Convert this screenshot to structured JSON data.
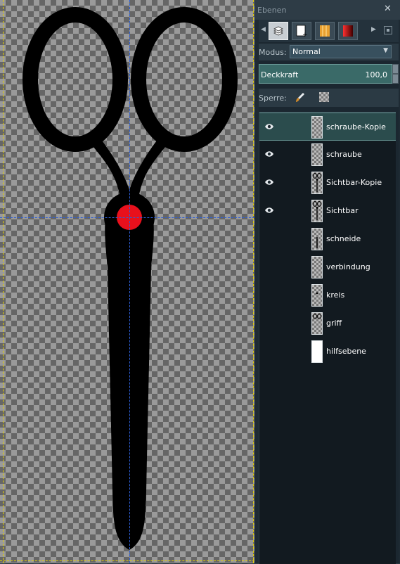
{
  "panel": {
    "title": "Ebenen",
    "close_glyph": "✕"
  },
  "tabs": [
    {
      "name": "layers-tab",
      "icon": "layers-icon",
      "active": true
    },
    {
      "name": "channels-tab",
      "icon": "channels-icon",
      "active": false
    },
    {
      "name": "paths-tab",
      "icon": "paths-icon",
      "active": false
    },
    {
      "name": "colormap-tab",
      "icon": "gradient-icon",
      "active": false
    }
  ],
  "mode": {
    "label": "Modus:",
    "value": "Normal"
  },
  "opacity": {
    "label": "Deckkraft",
    "value": "100,0"
  },
  "lock": {
    "label": "Sperre:"
  },
  "layers": [
    {
      "name": "schraube-Kopie",
      "visible": true,
      "selected": true,
      "thumb": "transparent"
    },
    {
      "name": "schraube",
      "visible": true,
      "selected": false,
      "thumb": "transparent"
    },
    {
      "name": "Sichtbar-Kopie",
      "visible": true,
      "selected": false,
      "thumb": "scissors"
    },
    {
      "name": "Sichtbar",
      "visible": true,
      "selected": false,
      "thumb": "scissors"
    },
    {
      "name": "schneide",
      "visible": false,
      "selected": false,
      "thumb": "blade"
    },
    {
      "name": "verbindung",
      "visible": false,
      "selected": false,
      "thumb": "transparent"
    },
    {
      "name": "kreis",
      "visible": false,
      "selected": false,
      "thumb": "dot"
    },
    {
      "name": "griff",
      "visible": false,
      "selected": false,
      "thumb": "handle"
    },
    {
      "name": "hilfsebene",
      "visible": false,
      "selected": false,
      "thumb": "white"
    }
  ],
  "colors": {
    "scissors": "#000000",
    "pivot": "#e8101c",
    "guide": "#2d5fd6",
    "selection": "#2b4c4d"
  }
}
